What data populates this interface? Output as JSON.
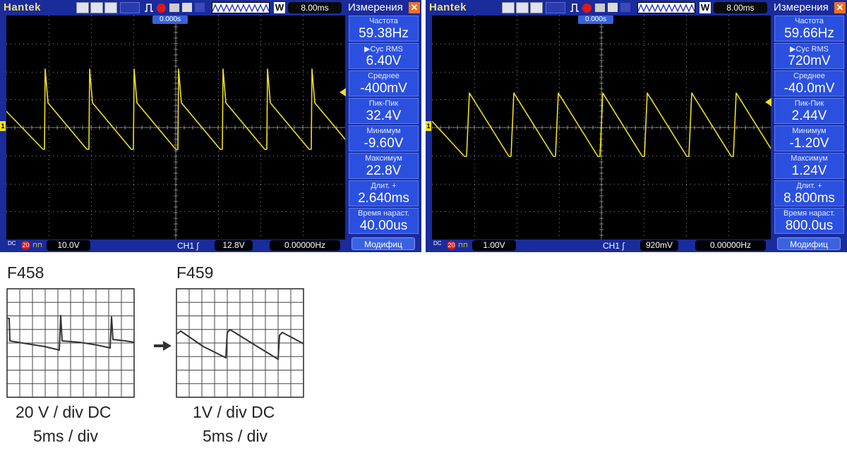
{
  "colors": {
    "scope_frame": "#1a2b9c",
    "screen": "#000000",
    "trace": "#f0e020",
    "panel_block": "#2b50e0",
    "accent_close": "#f07020"
  },
  "scopes": [
    {
      "brand": "Hantek",
      "timebase": "8.00ms",
      "trigger_pos": "0.000s",
      "channel_marker": "1",
      "panel": {
        "title": "Измерения",
        "close": "✕",
        "measurements": [
          {
            "label": "Частота",
            "value": "59.38Hz"
          },
          {
            "label": "▶Cyc RMS",
            "value": "6.40V"
          },
          {
            "label": "Среднее",
            "value": "-400mV"
          },
          {
            "label": "Пик-Пик",
            "value": "32.4V"
          },
          {
            "label": "Минимум",
            "value": "-9.60V"
          },
          {
            "label": "Максимум",
            "value": "22.8V"
          },
          {
            "label": "Длит. +",
            "value": "2.640ms"
          },
          {
            "label": "Время нараст.",
            "value": "40.00us"
          }
        ],
        "modify": "Модифиц"
      },
      "bottom": {
        "coupling": "DC",
        "bw": "20",
        "volts_div": "10.0V",
        "channel": "CH1",
        "trigger_level": "12.8V",
        "frequency": "0.00000Hz"
      }
    },
    {
      "brand": "Hantek",
      "timebase": "8.00ms",
      "trigger_pos": "0.000s",
      "channel_marker": "1",
      "panel": {
        "title": "Измерения",
        "close": "✕",
        "measurements": [
          {
            "label": "Частота",
            "value": "59.66Hz"
          },
          {
            "label": "▶Cyc RMS",
            "value": "720mV"
          },
          {
            "label": "Среднее",
            "value": "-40.0mV"
          },
          {
            "label": "Пик-Пик",
            "value": "2.44V"
          },
          {
            "label": "Минимум",
            "value": "-1.20V"
          },
          {
            "label": "Максимум",
            "value": "1.24V"
          },
          {
            "label": "Длит. +",
            "value": "8.800ms"
          },
          {
            "label": "Время нараст.",
            "value": "800.0us"
          }
        ],
        "modify": "Модифиц"
      },
      "bottom": {
        "coupling": "DC",
        "bw": "20",
        "volts_div": "1.00V",
        "channel": "CH1",
        "trigger_level": "920mV",
        "frequency": "0.00000Hz"
      }
    }
  ],
  "references": [
    {
      "title": "F458",
      "line1": "20 V / div DC",
      "line2": "5ms / div"
    },
    {
      "title": "F459",
      "line1": "1V / div DC",
      "line2": "5ms / div"
    }
  ]
}
